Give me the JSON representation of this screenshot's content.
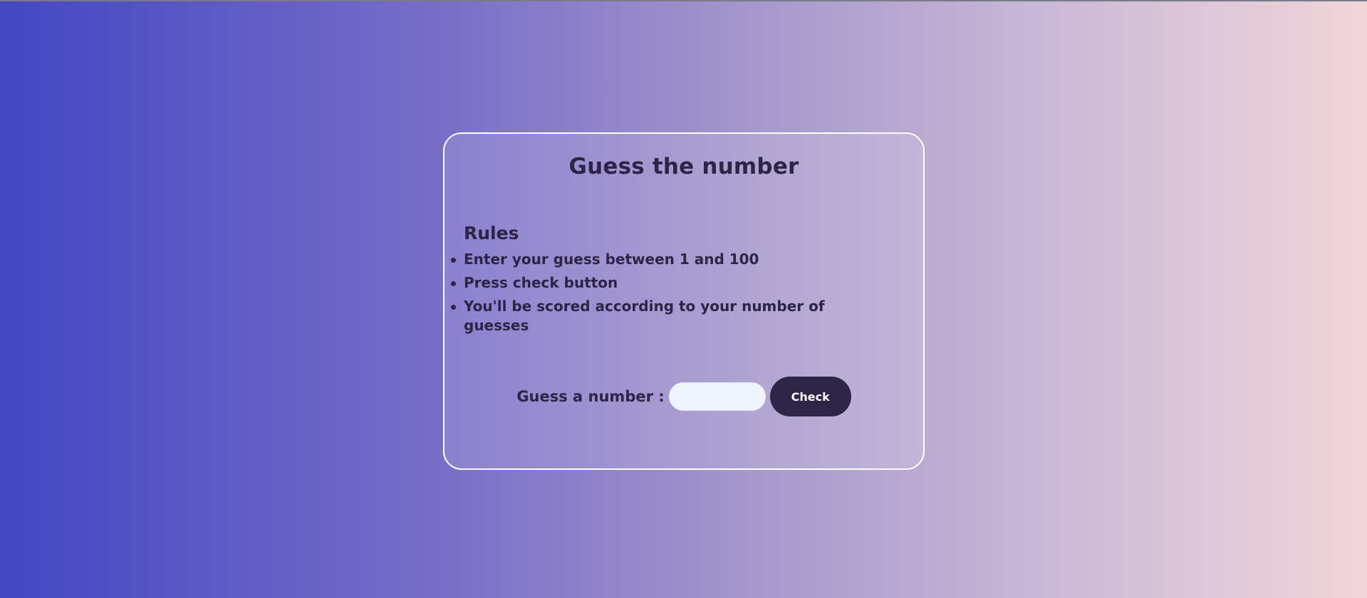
{
  "game": {
    "title": "Guess the number",
    "rules_heading": "Rules",
    "rules": [
      "Enter your guess between 1 and 100",
      "Press check button",
      "You'll be scored according to your number of guesses"
    ],
    "guess_label": "Guess a number :",
    "guess_input_value": "",
    "check_label": "Check"
  },
  "colors": {
    "background_start": "#4347c3",
    "background_end": "#f1d6d9",
    "text": "#2d2446",
    "button": "#2d2446",
    "input": "#eef5fd",
    "card_border": "#ffffff"
  }
}
